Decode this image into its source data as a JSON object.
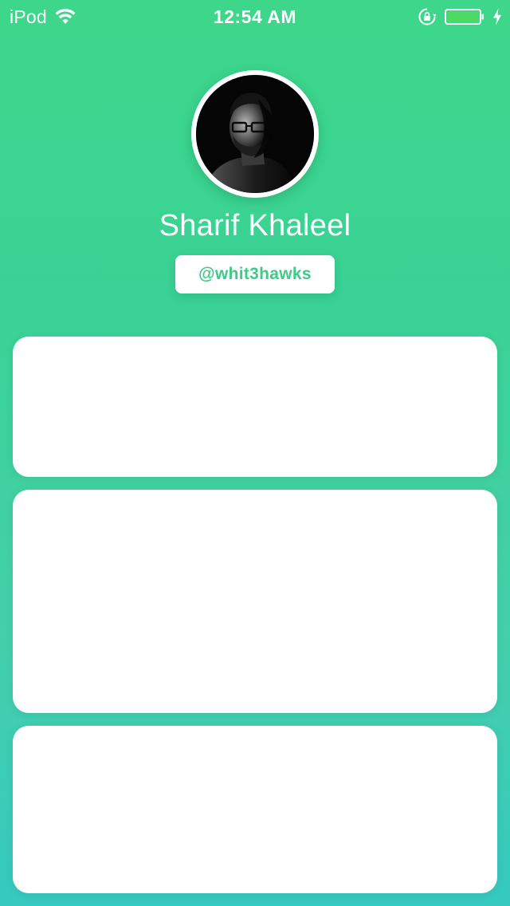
{
  "status_bar": {
    "carrier": "iPod",
    "time": "12:54 AM",
    "icons": [
      "wifi-icon",
      "orientation-lock-icon",
      "battery-icon",
      "charging-bolt-icon"
    ]
  },
  "profile": {
    "name": "Sharif Khaleel",
    "handle": "@whit3hawks",
    "avatar": "profile-photo"
  },
  "cards": [
    {
      "id": "card-1"
    },
    {
      "id": "card-2"
    },
    {
      "id": "card-3"
    }
  ],
  "colors": {
    "background_top": "#3dd68a",
    "background_bottom": "#35c9c0",
    "accent": "#3ccc86",
    "card": "#ffffff",
    "battery_fill": "#4cd964"
  }
}
